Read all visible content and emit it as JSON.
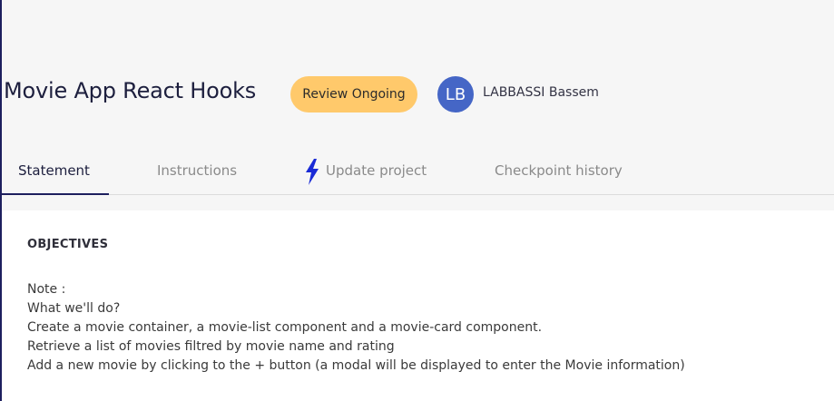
{
  "project": {
    "title": "Movie App React Hooks",
    "status": "Review Ongoing",
    "status_color": "#ffc96b",
    "user": {
      "initials": "LB",
      "name": "LABBASSI Bassem",
      "avatar_color": "#4566c6"
    }
  },
  "tabs": [
    {
      "label": "Statement",
      "active": true
    },
    {
      "label": "Instructions",
      "active": false
    },
    {
      "label": "Update project",
      "icon": "lightning-bolt-icon",
      "active": false
    },
    {
      "label": "Checkpoint history",
      "active": false
    }
  ],
  "accent_color": "#1d1f5e",
  "statement": {
    "heading": "OBJECTIVES",
    "lines": [
      "Note :",
      "What we'll do?",
      "Create a movie container, a movie-list component and a movie-card component.",
      "Retrieve a list of movies filtred by movie name and rating",
      "Add a new movie by clicking to the + button (a modal will be displayed to enter the Movie information)"
    ]
  }
}
